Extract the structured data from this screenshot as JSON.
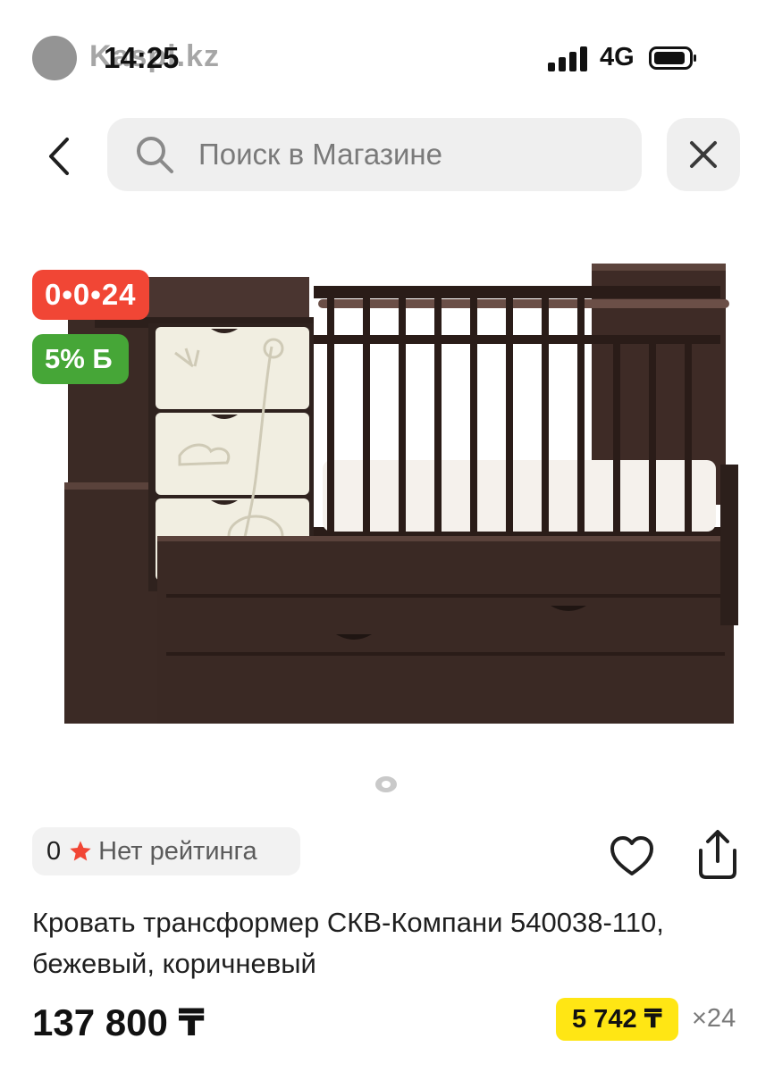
{
  "status_bar": {
    "app_brand": "Kaspi.kz",
    "time": "14:25",
    "network": "4G",
    "icons": [
      "kaspi-logo-icon",
      "signal-icon",
      "battery-icon"
    ]
  },
  "search": {
    "placeholder": "Поиск в Магазине",
    "icons": [
      "back-arrow-icon",
      "search-icon",
      "close-icon"
    ]
  },
  "product": {
    "badges": {
      "timer": "0•0•24",
      "bonus": "5% Б"
    },
    "rating": {
      "count": "0",
      "label": "Нет рейтинга"
    },
    "actions": [
      "heart-icon",
      "share-icon"
    ],
    "title": "Кровать трансформер СКВ-Компани 540038-110, бежевый, коричневый",
    "price": "137 800 ₸",
    "installment": {
      "monthly": "5 742 ₸",
      "term": "×24"
    }
  },
  "colors": {
    "timer_badge": "#f14635",
    "bonus_badge": "#46a637",
    "installment_badge": "#ffe614",
    "star": "#f14635"
  }
}
